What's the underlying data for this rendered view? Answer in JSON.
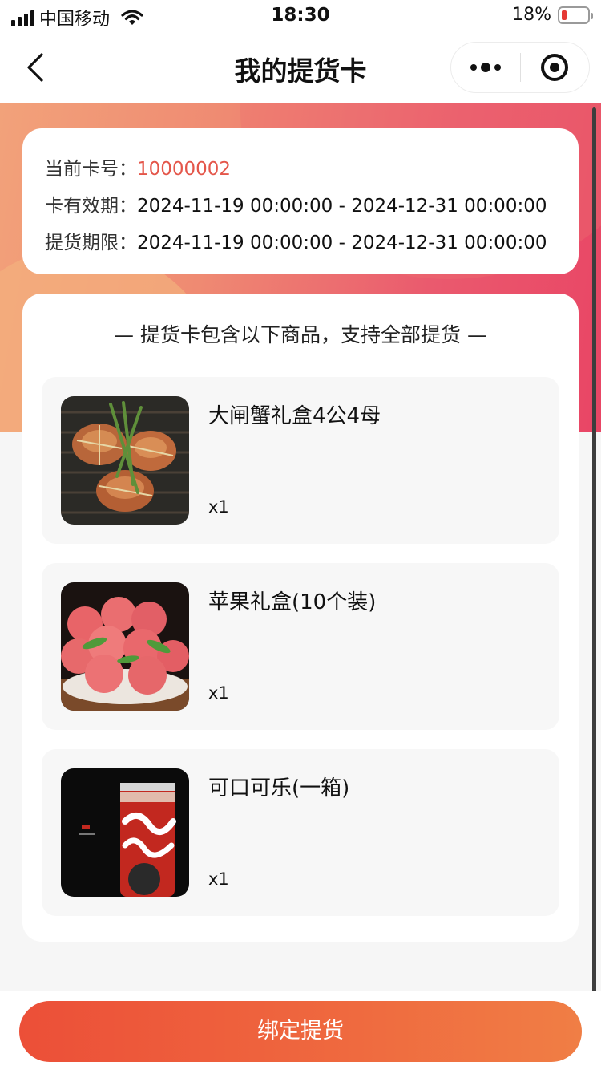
{
  "status_bar": {
    "carrier": "中国移动",
    "time": "18:30",
    "battery": "18%",
    "battery_level": 0.18,
    "battery_color": "#e53935"
  },
  "nav": {
    "title": "我的提货卡",
    "back_icon": "chevron-left-icon",
    "more_icon": "more-dots-icon",
    "close_icon": "target-icon"
  },
  "card_info": {
    "card_no_label": "当前卡号：",
    "card_no": "10000002",
    "validity_label": "卡有效期：",
    "validity": "2024-11-19 00:00:00 - 2024-12-31 00:00:00",
    "pickup_label": "提货期限：",
    "pickup": "2024-11-19 00:00:00 - 2024-12-31 00:00:00"
  },
  "goods": {
    "heading": "— 提货卡包含以下商品，支持全部提货 —",
    "items": [
      {
        "name": "大闸蟹礼盒4公4母",
        "qty": "x1",
        "image": "crab-image"
      },
      {
        "name": "苹果礼盒(10个装)",
        "qty": "x1",
        "image": "apple-image"
      },
      {
        "name": "可口可乐(一箱)",
        "qty": "x1",
        "image": "cola-image"
      }
    ]
  },
  "bottom": {
    "bind_button": "绑定提货"
  },
  "colors": {
    "accent_red": "#e4564a",
    "button_gradient_start": "#ec4f38",
    "button_gradient_end": "#f07e45",
    "header_gradient_start": "#f2a27a",
    "header_gradient_end": "#e94565"
  }
}
